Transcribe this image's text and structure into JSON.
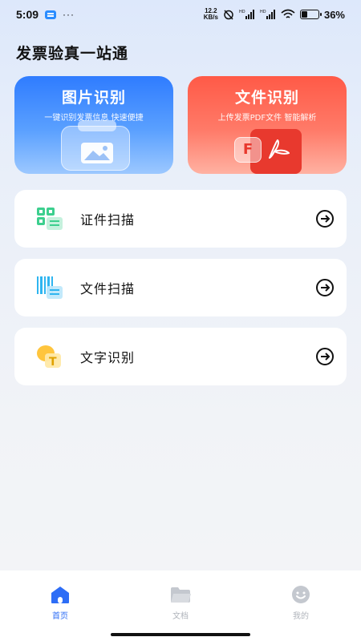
{
  "status_bar": {
    "time": "5:09",
    "dots": "···",
    "net_speed_value": "12.2",
    "net_speed_unit": "KB/s",
    "battery_percent": "36%",
    "battery_level": 0.36
  },
  "page": {
    "title": "发票验真一站通"
  },
  "cards": [
    {
      "title": "图片识别",
      "subtitle": "一键识别发票信息 快速便捷",
      "color": "#2f7cff"
    },
    {
      "title": "文件识别",
      "subtitle": "上传发票PDF文件 智能解析",
      "color": "#ff5a47",
      "badge": "F"
    }
  ],
  "list": [
    {
      "label": "证件扫描",
      "icon": "id-scan-icon"
    },
    {
      "label": "文件扫描",
      "icon": "barcode-scan-icon"
    },
    {
      "label": "文字识别",
      "icon": "text-recognition-icon"
    }
  ],
  "tabs": [
    {
      "label": "首页",
      "icon": "home-icon",
      "active": true
    },
    {
      "label": "文档",
      "icon": "folder-icon",
      "active": false
    },
    {
      "label": "我的",
      "icon": "smiley-icon",
      "active": false
    }
  ],
  "colors": {
    "accent": "#2d6df6",
    "inactive": "#b0b4bb"
  }
}
